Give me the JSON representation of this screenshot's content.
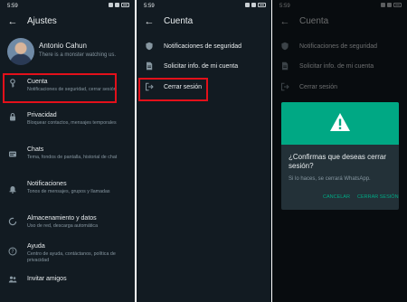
{
  "status_time": "5:59",
  "settings": {
    "title": "Ajustes",
    "profile": {
      "name": "Antonio Cahun",
      "status": "There is a monster watching us."
    },
    "items": [
      {
        "icon": "key-icon",
        "title": "Cuenta",
        "subtitle": "Notificaciones de seguridad, cerrar sesión"
      },
      {
        "icon": "lock-icon",
        "title": "Privacidad",
        "subtitle": "Bloquear contactos, mensajes temporales"
      },
      {
        "icon": "chat-icon",
        "title": "Chats",
        "subtitle": "Tema, fondos de pantalla, historial de chat"
      },
      {
        "icon": "bell-icon",
        "title": "Notificaciones",
        "subtitle": "Tonos de mensajes, grupos y llamadas"
      },
      {
        "icon": "storage-icon",
        "title": "Almacenamiento y datos",
        "subtitle": "Uso de red, descarga automática"
      },
      {
        "icon": "help-icon",
        "title": "Ayuda",
        "subtitle": "Centro de ayuda, contáctanos, política de privacidad"
      },
      {
        "icon": "people-icon",
        "title": "Invitar amigos",
        "subtitle": ""
      }
    ]
  },
  "account": {
    "title": "Cuenta",
    "items": [
      {
        "icon": "shield-icon",
        "title": "Notificaciones de seguridad"
      },
      {
        "icon": "document-icon",
        "title": "Solicitar info. de mi cuenta"
      },
      {
        "icon": "logout-icon",
        "title": "Cerrar sesión"
      }
    ]
  },
  "dialog": {
    "title": "¿Confirmas que deseas cerrar sesión?",
    "message": "Si lo haces, se cerrará WhatsApp.",
    "cancel_label": "CANCELAR",
    "confirm_label": "CERRAR SESIÓN"
  },
  "colors": {
    "background": "#121b22",
    "accent": "#00a884",
    "highlight": "#e3101a"
  }
}
